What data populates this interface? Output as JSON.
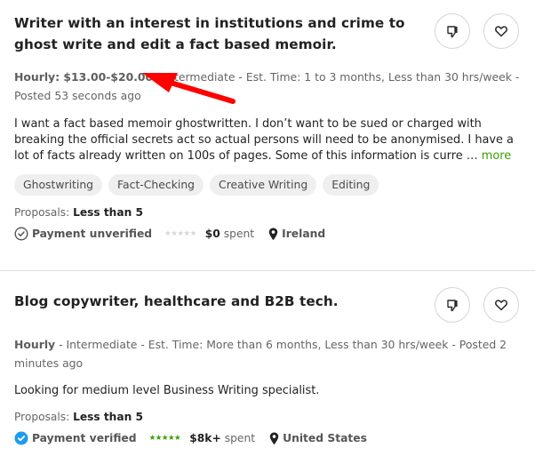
{
  "jobs": [
    {
      "title": "Writer with an interest in institutions and crime to ghost write and edit a fact based memoir.",
      "meta_bold": "Hourly: $13.00-$20.00",
      "meta_rest": " - Intermediate - Est. Time: 1 to 3 months, Less than 30 hrs/week - Posted 53 seconds ago",
      "description": "I want a fact based memoir ghostwritten. I don’t want to be sued or charged with breaking the official secrets act so actual persons will need to be anonymised. I have a lot of facts already written on 100s of pages. Some of this information is curre … ",
      "more_label": "more",
      "skills": [
        "Ghostwriting",
        "Fact-Checking",
        "Creative Writing",
        "Editing"
      ],
      "proposals_label": "Proposals: ",
      "proposals_value": "Less than 5",
      "payment_status": "Payment unverified",
      "payment_icon": "check-circle-outline-icon",
      "rating": 0,
      "rating_max": 5,
      "spent_value": "$0",
      "spent_label": " spent",
      "location": "Ireland",
      "actions": {
        "dislike_icon": "thumbs-down-icon",
        "save_icon": "heart-icon"
      }
    },
    {
      "title": "Blog copywriter, healthcare and B2B tech.",
      "meta_bold": "Hourly",
      "meta_rest": " - Intermediate - Est. Time: More than 6 months, Less than 30 hrs/week - Posted 2 minutes ago",
      "description": "Looking for medium level Business Writing specialist.",
      "proposals_label": "Proposals: ",
      "proposals_value": "Less than 5",
      "payment_status": "Payment verified",
      "payment_icon": "verified-badge-icon",
      "rating": 5,
      "rating_max": 5,
      "spent_value": "$8k+",
      "spent_label": " spent",
      "location": "United States",
      "actions": {
        "dislike_icon": "thumbs-down-icon",
        "save_icon": "heart-icon"
      }
    }
  ],
  "colors": {
    "accent_green": "#37a000",
    "verified_blue": "#1d9bf0",
    "annotation_red": "#ff0000"
  },
  "star_glyph": "★★★★★"
}
